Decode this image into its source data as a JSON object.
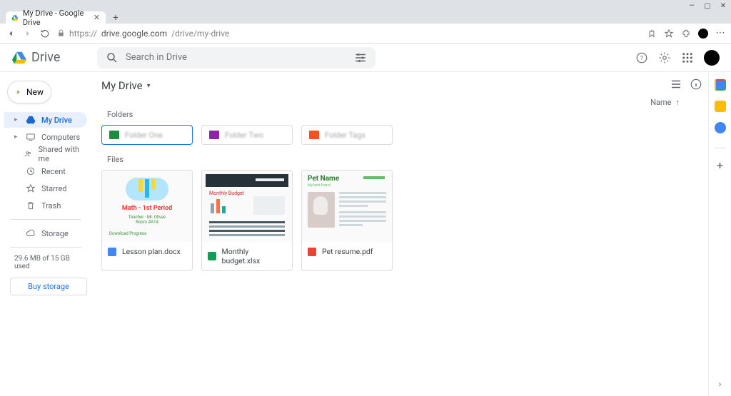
{
  "browser": {
    "tab_title": "My Drive - Google Drive",
    "url_host": "drive.google.com",
    "url_path": "/drive/my-drive",
    "url_scheme": "https://"
  },
  "header": {
    "product": "Drive",
    "search_placeholder": "Search in Drive"
  },
  "sidebar": {
    "new_label": "New",
    "items": [
      {
        "label": "My Drive",
        "icon": "drive"
      },
      {
        "label": "Computers",
        "icon": "computers"
      },
      {
        "label": "Shared with me",
        "icon": "shared"
      },
      {
        "label": "Recent",
        "icon": "recent"
      },
      {
        "label": "Starred",
        "icon": "star"
      },
      {
        "label": "Trash",
        "icon": "trash"
      }
    ],
    "storage_label": "Storage",
    "storage_used": "29.6 MB of 15 GB used",
    "buy_label": "Buy storage"
  },
  "content": {
    "breadcrumb": "My Drive",
    "section_folders": "Folders",
    "section_files": "Files",
    "sort_label": "Name",
    "folders": [
      {
        "name": "Folder One",
        "color": "#1e8e3e"
      },
      {
        "name": "Folder Two",
        "color": "#8e24aa"
      },
      {
        "name": "Folder Tags",
        "color": "#f4511e"
      }
    ],
    "files": [
      {
        "name": "Lesson plan.docx",
        "type": "docs",
        "icon_color": "#4285f4",
        "thumb_title": "Math - 1st Period"
      },
      {
        "name": "Monthly budget.xlsx",
        "type": "sheets",
        "icon_color": "#0f9d58",
        "thumb_title": "Monthly Budget"
      },
      {
        "name": "Pet resume.pdf",
        "type": "pdf",
        "icon_color": "#ea4335",
        "thumb_title": "Pet Name"
      }
    ]
  }
}
